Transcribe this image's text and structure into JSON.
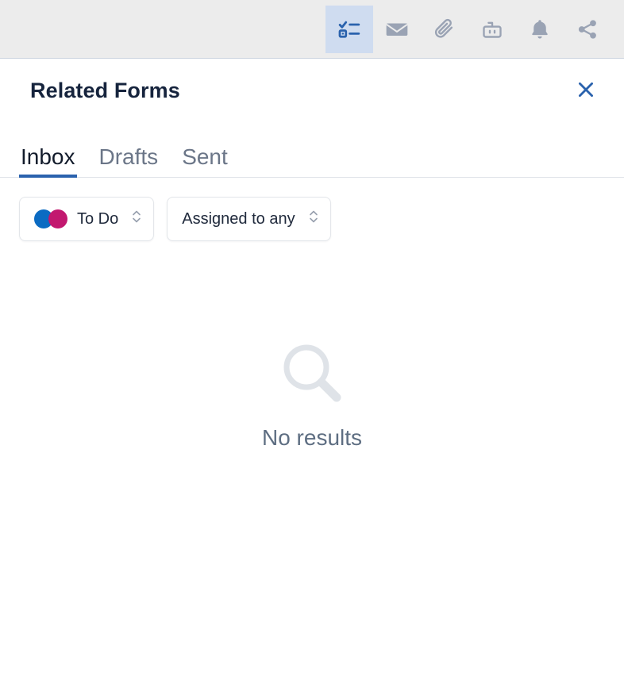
{
  "toolbar": {
    "buttons": [
      {
        "name": "tasks-icon",
        "label": "Tasks",
        "active": true
      },
      {
        "name": "mail-icon",
        "label": "Mail",
        "active": false
      },
      {
        "name": "paperclip-icon",
        "label": "Attachments",
        "active": false
      },
      {
        "name": "robot-icon",
        "label": "Bot",
        "active": false
      },
      {
        "name": "bell-icon",
        "label": "Notifications",
        "active": false
      },
      {
        "name": "share-icon",
        "label": "Share",
        "active": false
      }
    ],
    "colors": {
      "background": "#ececec",
      "icon": "#9aa3b4",
      "active_icon": "#2a62ad",
      "active_background": "#cfdcf0"
    }
  },
  "header": {
    "title": "Related Forms",
    "close_label": "✕",
    "title_color": "#16243d",
    "close_color": "#2a62ad"
  },
  "tabs": [
    {
      "label": "Inbox",
      "active": true
    },
    {
      "label": "Drafts",
      "active": false
    },
    {
      "label": "Sent",
      "active": false
    }
  ],
  "tab_accent_color": "#2a62ad",
  "filters": [
    {
      "name": "status-filter",
      "label": "To Do",
      "has_swatch": true,
      "swatch_colors": [
        "#0b6bc2",
        "#c2186f"
      ]
    },
    {
      "name": "assignee-filter",
      "label": "Assigned to any",
      "has_swatch": false,
      "swatch_colors": []
    }
  ],
  "empty_state": {
    "icon": "magnifier-icon",
    "message": "No results",
    "icon_color": "#dfe3e8",
    "text_color": "#5e6e82"
  }
}
